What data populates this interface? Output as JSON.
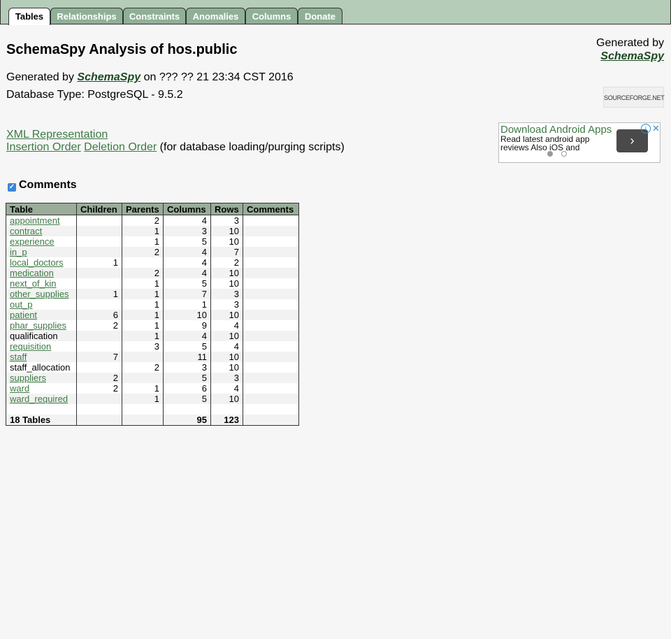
{
  "tabs": [
    "Tables",
    "Relationships",
    "Constraints",
    "Anomalies",
    "Columns",
    "Donate"
  ],
  "header": {
    "title": "SchemaSpy Analysis of hos.public",
    "generated_prefix": "Generated by",
    "generated_brand": "SchemaSpy",
    "generated_suffix": "on ??? ?? 21 23:34 CST 2016",
    "db_type": "Database Type: PostgreSQL - 9.5.2"
  },
  "right_generated": {
    "line1": "Generated by",
    "brand": "SchemaSpy"
  },
  "sourceforge_logo": "SOURCEFORGE.NET",
  "links": {
    "xml": "XML Representation",
    "insertion": "Insertion Order",
    "deletion": "Deletion Order",
    "suffix": "(for database loading/purging scripts)"
  },
  "ad": {
    "title": "Download Android Apps",
    "text": "Read latest android app reviews Also iOS and",
    "next": "›",
    "info": "i",
    "close": "✕"
  },
  "comments_toggle": {
    "label": "Comments",
    "checked": true
  },
  "table": {
    "headers": [
      "Table",
      "Children",
      "Parents",
      "Columns",
      "Rows",
      "Comments"
    ],
    "rows": [
      {
        "name": "appointment",
        "link": true,
        "children": "",
        "parents": "2",
        "columns": "4",
        "rows": "3",
        "comments": ""
      },
      {
        "name": "contract",
        "link": true,
        "children": "",
        "parents": "1",
        "columns": "3",
        "rows": "10",
        "comments": ""
      },
      {
        "name": "experience",
        "link": true,
        "children": "",
        "parents": "1",
        "columns": "5",
        "rows": "10",
        "comments": ""
      },
      {
        "name": "in_p",
        "link": true,
        "children": "",
        "parents": "2",
        "columns": "4",
        "rows": "7",
        "comments": ""
      },
      {
        "name": "local_doctors",
        "link": true,
        "children": "1",
        "parents": "",
        "columns": "4",
        "rows": "2",
        "comments": ""
      },
      {
        "name": "medication",
        "link": true,
        "children": "",
        "parents": "2",
        "columns": "4",
        "rows": "10",
        "comments": ""
      },
      {
        "name": "next_of_kin",
        "link": true,
        "children": "",
        "parents": "1",
        "columns": "5",
        "rows": "10",
        "comments": ""
      },
      {
        "name": "other_supplies",
        "link": true,
        "children": "1",
        "parents": "1",
        "columns": "7",
        "rows": "3",
        "comments": ""
      },
      {
        "name": "out_p",
        "link": true,
        "children": "",
        "parents": "1",
        "columns": "1",
        "rows": "3",
        "comments": ""
      },
      {
        "name": "patient",
        "link": true,
        "children": "6",
        "parents": "1",
        "columns": "10",
        "rows": "10",
        "comments": ""
      },
      {
        "name": "phar_supplies",
        "link": true,
        "children": "2",
        "parents": "1",
        "columns": "9",
        "rows": "4",
        "comments": ""
      },
      {
        "name": "qualification",
        "link": false,
        "children": "",
        "parents": "1",
        "columns": "4",
        "rows": "10",
        "comments": ""
      },
      {
        "name": "requisition",
        "link": true,
        "children": "",
        "parents": "3",
        "columns": "5",
        "rows": "4",
        "comments": ""
      },
      {
        "name": "staff",
        "link": true,
        "children": "7",
        "parents": "",
        "columns": "11",
        "rows": "10",
        "comments": ""
      },
      {
        "name": "staff_allocation",
        "link": false,
        "children": "",
        "parents": "2",
        "columns": "3",
        "rows": "10",
        "comments": ""
      },
      {
        "name": "suppliers",
        "link": true,
        "children": "2",
        "parents": "",
        "columns": "5",
        "rows": "3",
        "comments": ""
      },
      {
        "name": "ward",
        "link": true,
        "children": "2",
        "parents": "1",
        "columns": "6",
        "rows": "4",
        "comments": ""
      },
      {
        "name": "ward_required",
        "link": true,
        "children": "",
        "parents": "1",
        "columns": "5",
        "rows": "10",
        "comments": ""
      }
    ],
    "footer": {
      "label": "18 Tables",
      "columns": "95",
      "rows": "123"
    }
  },
  "colors": {
    "tabbar": "#b5ccb9",
    "tab": "#8fb096",
    "header_bg": "#99ad99",
    "link": "#3d7a44"
  }
}
